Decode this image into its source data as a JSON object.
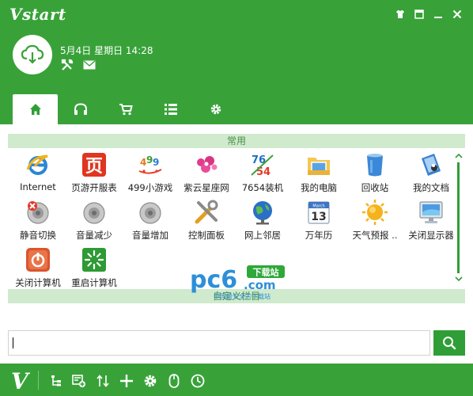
{
  "app": {
    "brand": "Vstart",
    "colors": {
      "primary": "#38a239",
      "accent": "#2f9e36",
      "section_bg": "#cfeacd",
      "section_text": "#4c8f49"
    }
  },
  "window_controls": [
    {
      "name": "skin-icon"
    },
    {
      "name": "menu-icon"
    },
    {
      "name": "minimize-icon"
    },
    {
      "name": "close-icon"
    }
  ],
  "header": {
    "weather_icon": "cloud-download-icon",
    "datetime": "5月4日 星期日 14:28",
    "icons": [
      "tools-icon",
      "mail-icon"
    ]
  },
  "tabs": [
    {
      "name": "home-icon",
      "active": true
    },
    {
      "name": "headphones-icon",
      "active": false
    },
    {
      "name": "cart-icon",
      "active": false
    },
    {
      "name": "list-icon",
      "active": false
    },
    {
      "name": "gear-icon",
      "active": false
    }
  ],
  "sections": {
    "common": "常用",
    "custom": "自定义栏目"
  },
  "items": [
    {
      "label": "Internet",
      "icon": "ie-icon"
    },
    {
      "label": "页游开服表",
      "icon": "page-game-icon"
    },
    {
      "label": "499小游戏",
      "icon": "499-games-icon"
    },
    {
      "label": "紫云星座网",
      "icon": "horoscope-icon"
    },
    {
      "label": "7654装机",
      "icon": "7654-icon"
    },
    {
      "label": "我的电脑",
      "icon": "my-computer-icon"
    },
    {
      "label": "回收站",
      "icon": "recycle-bin-icon"
    },
    {
      "label": "我的文档",
      "icon": "my-documents-icon"
    },
    {
      "label": "静音切换",
      "icon": "mute-icon"
    },
    {
      "label": "音量减少",
      "icon": "volume-down-icon"
    },
    {
      "label": "音量增加",
      "icon": "volume-up-icon"
    },
    {
      "label": "控制面板",
      "icon": "control-panel-icon"
    },
    {
      "label": "网上邻居",
      "icon": "network-icon"
    },
    {
      "label": "万年历",
      "icon": "calendar-icon"
    },
    {
      "label": "天气预报 ..",
      "icon": "weather-icon"
    },
    {
      "label": "关闭显示器",
      "icon": "monitor-icon"
    },
    {
      "label": "关闭计算机",
      "icon": "shutdown-icon"
    },
    {
      "label": "重启计算机",
      "icon": "restart-icon"
    }
  ],
  "calendar_icon": {
    "month": "March",
    "day": "13"
  },
  "watermark": {
    "logo": "pc6",
    "badge": "下载站",
    "domain": ".com",
    "tagline": "中国最安全的下载站"
  },
  "search": {
    "value": "",
    "button_icon": "search-icon"
  },
  "bottom_bar": {
    "logo": "V",
    "icons": [
      "tree-icon",
      "add-shortcut-icon",
      "sort-icon",
      "plus-icon",
      "settings-icon",
      "mouse-icon",
      "clock-icon"
    ]
  }
}
